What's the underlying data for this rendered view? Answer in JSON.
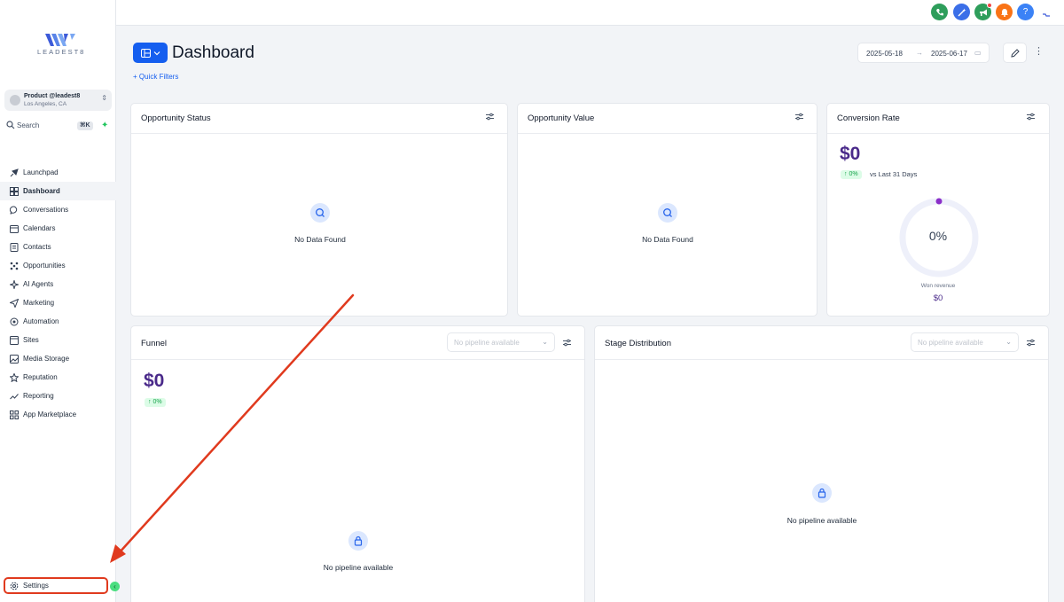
{
  "sidebar": {
    "logo_text": "LEADEST8",
    "location": {
      "name": "Product @leadest8",
      "city": "Los Angeles, CA"
    },
    "search": {
      "label": "Search",
      "shortcut": "⌘K"
    },
    "nav": [
      {
        "label": "Launchpad",
        "icon": "rocket-icon"
      },
      {
        "label": "Dashboard",
        "icon": "dashboard-icon",
        "active": true
      },
      {
        "label": "Conversations",
        "icon": "chat-icon"
      },
      {
        "label": "Calendars",
        "icon": "calendar-icon"
      },
      {
        "label": "Contacts",
        "icon": "contacts-icon"
      },
      {
        "label": "Opportunities",
        "icon": "opportunities-icon"
      },
      {
        "label": "AI Agents",
        "icon": "sparkle-icon"
      },
      {
        "label": "Marketing",
        "icon": "send-icon"
      },
      {
        "label": "Automation",
        "icon": "automation-icon"
      },
      {
        "label": "Sites",
        "icon": "sites-icon"
      },
      {
        "label": "Media Storage",
        "icon": "image-icon"
      },
      {
        "label": "Reputation",
        "icon": "star-icon"
      },
      {
        "label": "Reporting",
        "icon": "trend-icon"
      },
      {
        "label": "App Marketplace",
        "icon": "grid-icon"
      }
    ],
    "settings_label": "Settings"
  },
  "topbar": {
    "buttons": [
      {
        "icon": "phone-icon",
        "color": "#2e9e5b"
      },
      {
        "icon": "magic-icon",
        "color": "#3b6fe8"
      },
      {
        "icon": "megaphone-icon",
        "color": "#2e9e5b"
      },
      {
        "icon": "bell-icon",
        "color": "#f97316"
      },
      {
        "icon": "help-icon",
        "color": "#3b82f6",
        "label": "?"
      }
    ]
  },
  "header": {
    "title": "Dashboard",
    "quick_filters": "+ Quick Filters",
    "date_start": "2025-05-18",
    "date_end": "2025-06-17"
  },
  "cards": {
    "opportunity_status": {
      "title": "Opportunity Status",
      "empty": "No Data Found"
    },
    "opportunity_value": {
      "title": "Opportunity Value",
      "empty": "No Data Found"
    },
    "conversion_rate": {
      "title": "Conversion Rate",
      "value": "$0",
      "change": "↑ 0%",
      "compare": "vs Last 31 Days",
      "donut_pct": "0%",
      "won_label": "Won revenue",
      "won_value": "$0"
    },
    "funnel": {
      "title": "Funnel",
      "select_placeholder": "No pipeline available",
      "value": "$0",
      "change": "↑ 0%",
      "empty": "No pipeline available"
    },
    "stage_distribution": {
      "title": "Stage Distribution",
      "select_placeholder": "No pipeline available",
      "empty": "No pipeline available"
    }
  },
  "colors": {
    "accent": "#155eef",
    "value_purple": "#4a2a8a",
    "annotation_red": "#e03a1e"
  }
}
